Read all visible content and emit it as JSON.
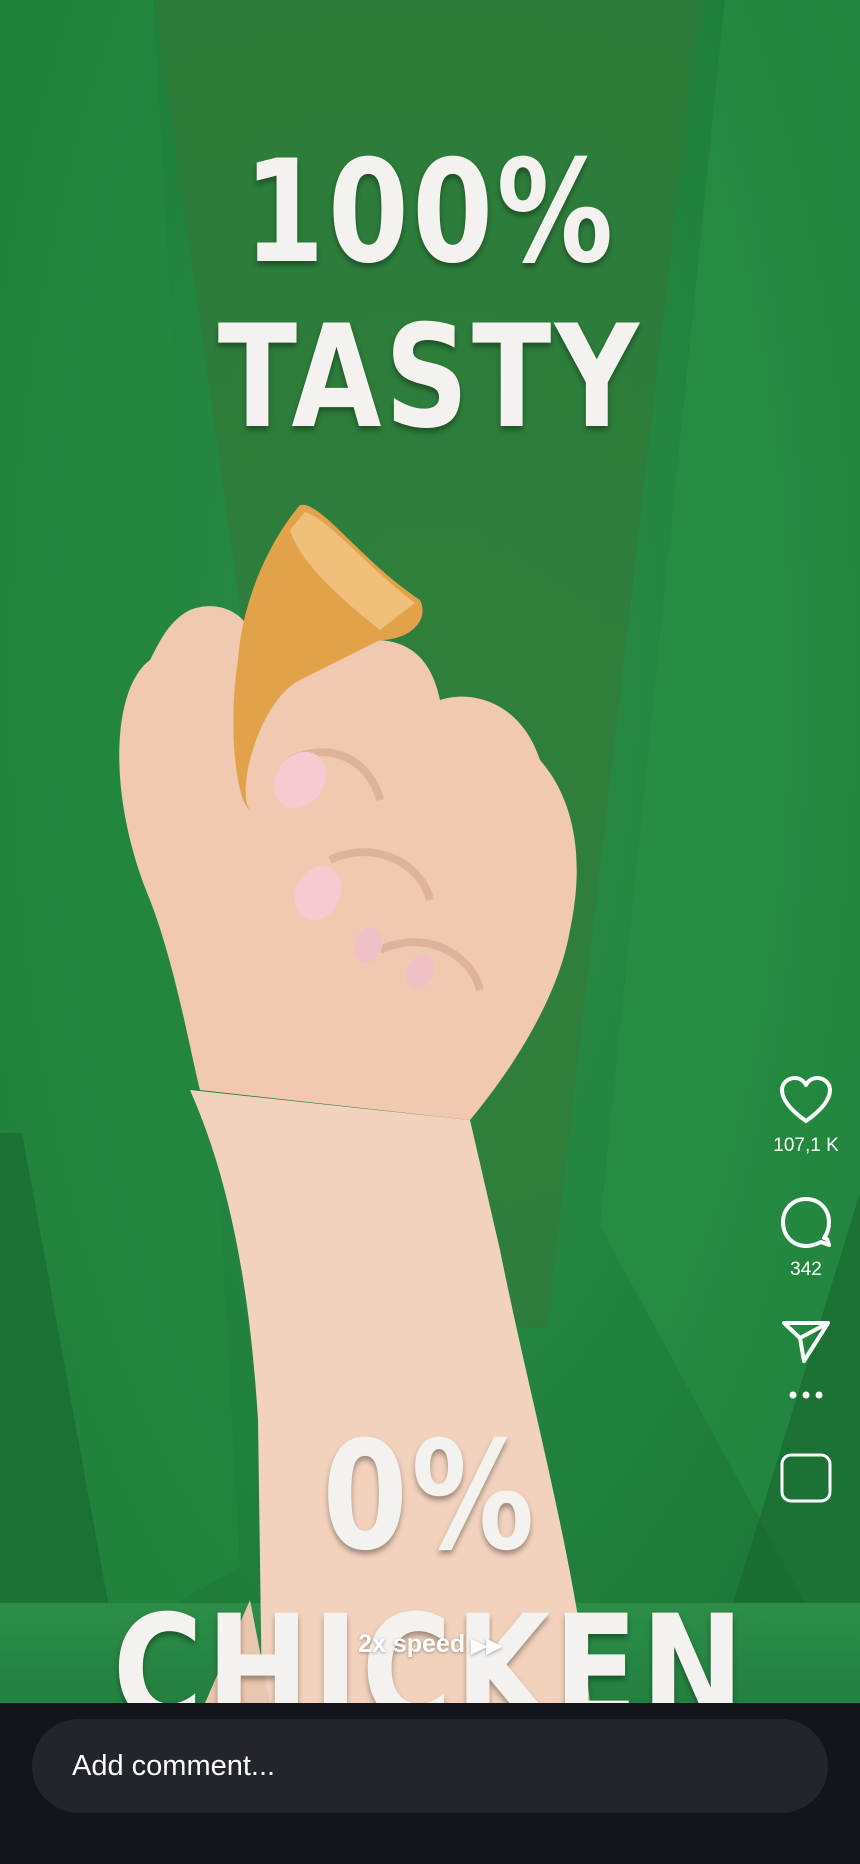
{
  "video": {
    "headline_top": "100% TASTY",
    "headline_bottom": "0% CHICKEN",
    "speed_label": "2x speed",
    "speed_icon": "fast-forward-icon"
  },
  "actions": {
    "like": {
      "icon": "heart-icon",
      "count": "107,1 K"
    },
    "comment": {
      "icon": "comment-bubble-icon",
      "count": "342"
    },
    "share": {
      "icon": "paper-plane-icon"
    },
    "more": {
      "icon": "more-dots-icon"
    },
    "audio": {
      "icon": "audio-thumbnail-icon"
    }
  },
  "comment_bar": {
    "placeholder": "Add comment..."
  },
  "colors": {
    "background_green": "#23853f",
    "bottom_bar": "#14151a",
    "input_bg": "#23252d",
    "text": "#ffffff"
  }
}
